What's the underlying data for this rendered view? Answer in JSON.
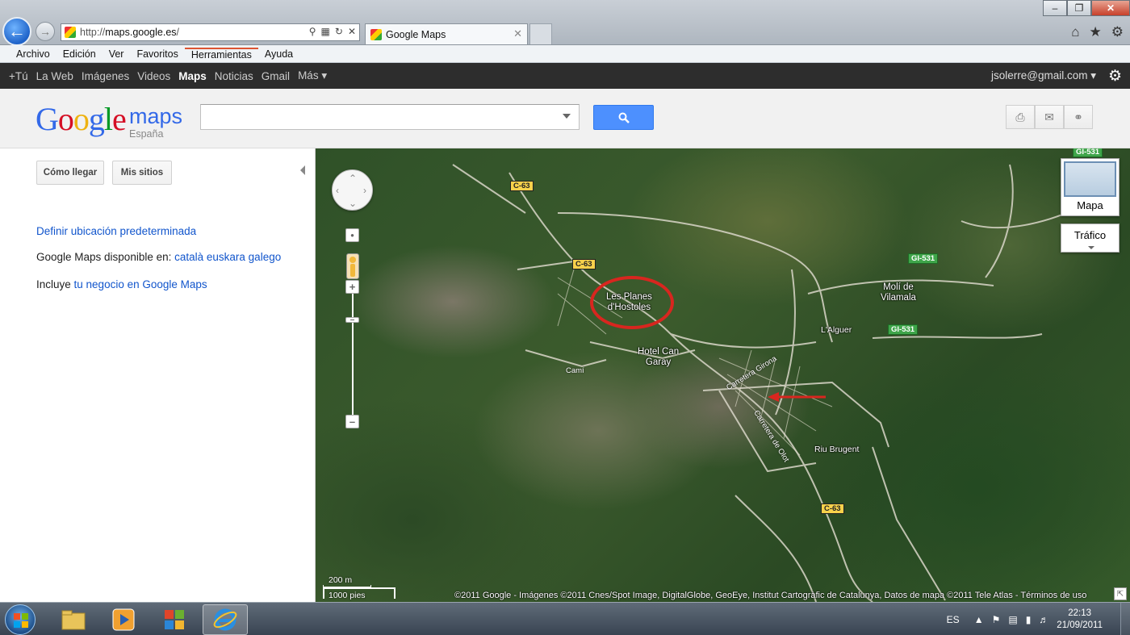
{
  "browser": {
    "url_prefix": "http://",
    "url_host": "maps.google.es",
    "url_suffix": "/",
    "tab_title": "Google Maps",
    "menu": [
      "Archivo",
      "Edición",
      "Ver",
      "Favoritos",
      "Herramientas",
      "Ayuda"
    ]
  },
  "gbar": {
    "links": [
      "+Tú",
      "La Web",
      "Imágenes",
      "Videos",
      "Maps",
      "Noticias",
      "Gmail",
      "Más ▾"
    ],
    "account": "jsolerre@gmail.com ▾"
  },
  "header": {
    "logo_google": [
      "G",
      "o",
      "o",
      "g",
      "l",
      "e"
    ],
    "logo_maps": "maps",
    "logo_country": "España",
    "search_value": "",
    "search_placeholder": ""
  },
  "left": {
    "btn_directions": "Cómo llegar",
    "btn_myplaces": "Mis sitios",
    "link_default_location": "Definir ubicación predeterminada",
    "available_prefix": "Google Maps disponible en: ",
    "available_langs": "català euskara galego",
    "include_prefix": "Incluye ",
    "include_link": "tu negocio en Google Maps"
  },
  "map": {
    "maptype_label": "Mapa",
    "traffic_label": "Tráfico",
    "place_les_planes_1": "Les Planes",
    "place_les_planes_2": "d'Hostoles",
    "place_hotel_1": "Hotel Can",
    "place_hotel_2": "Garay",
    "place_moli_1": "Molí de",
    "place_moli_2": "Vilamala",
    "place_alguer": "L'Alguer",
    "place_riu": "Riu Brugent",
    "road_c63": "C-63",
    "road_gi531": "GI-531",
    "street_girona": "Carretera Girona",
    "street_olot": "Carretera de Olot",
    "street_cami": "Camí",
    "scale_m": "200 m",
    "scale_ft": "1000 pies",
    "copyright": "©2011 Google - Imágenes ©2011 Cnes/Spot Image, DigitalGlobe, GeoEye, Institut Cartogràfic de Catalunya, Datos de mapa ©2011 Tele Atlas - Términos de uso"
  },
  "taskbar": {
    "lang": "ES",
    "time": "22:13",
    "date": "21/09/2011"
  },
  "colors": {
    "accent_blue": "#4d90fe",
    "link_blue": "#1155cc",
    "marker_red": "#d8261f"
  }
}
